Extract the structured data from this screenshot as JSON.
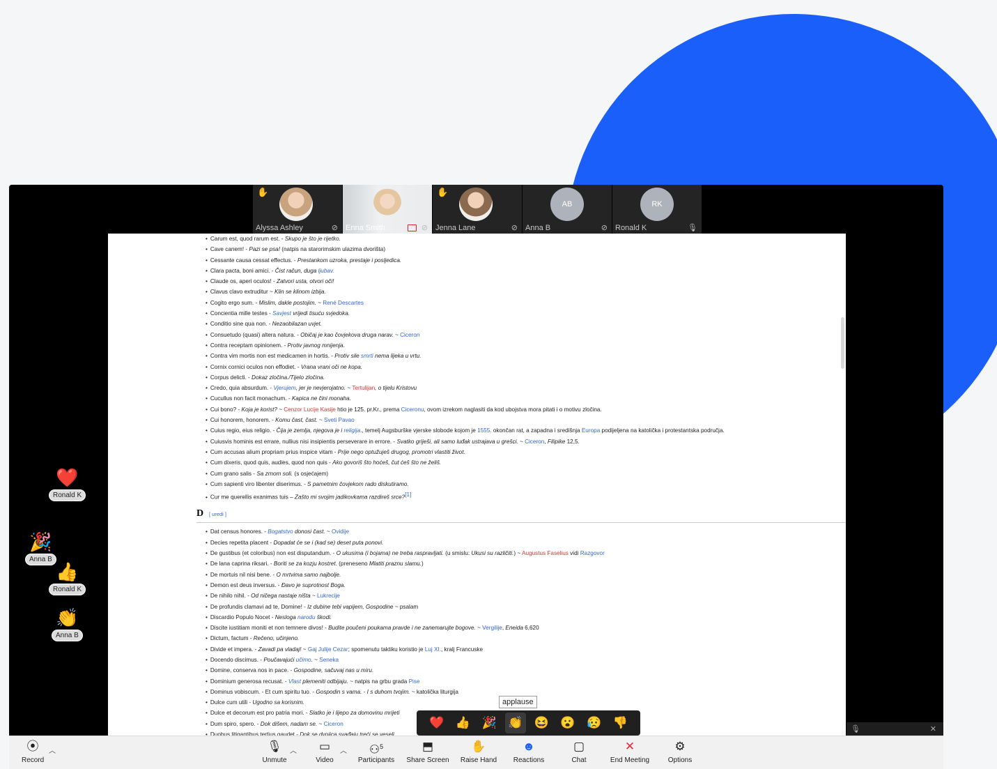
{
  "participants": [
    {
      "name": "Alyssa Ashley",
      "hand": true,
      "type": "photo",
      "color": "#c9a27e",
      "mic": "muted"
    },
    {
      "name": "Enna Smith",
      "hand": false,
      "type": "video",
      "color": "#e2d4c4",
      "mic": "muted",
      "sharing": true
    },
    {
      "name": "Jenna Lane",
      "hand": true,
      "type": "photo",
      "color": "#8c6a4f",
      "mic": "muted"
    },
    {
      "name": "Anna B",
      "hand": false,
      "type": "initials",
      "initials": "AB",
      "mic": "muted"
    },
    {
      "name": "Ronald K",
      "hand": false,
      "type": "initials",
      "initials": "RK",
      "mic": "on"
    }
  ],
  "doc": {
    "edit_label": "[ uredi ]",
    "section_letter": "D",
    "c_entries": [
      [
        {
          "t": "Carum est, quod rarum est. - "
        },
        {
          "t": "Skupo je što je rijetko.",
          "s": "i"
        }
      ],
      [
        {
          "t": "Cave canem! - "
        },
        {
          "t": "Pazi se psa!",
          "s": "i"
        },
        {
          "t": " (natpis na starorimskim ulazima dvorišta)"
        }
      ],
      [
        {
          "t": "Cessante causa cessat effectus. - "
        },
        {
          "t": "Prestankom uzroka, prestaje i posljedica.",
          "s": "i"
        }
      ],
      [
        {
          "t": "Clara pacta, boni amici. - "
        },
        {
          "t": "Čist račun, duga ",
          "s": "i"
        },
        {
          "t": "ljubav.",
          "s": "il"
        }
      ],
      [
        {
          "t": "Claude os, aperi oculos! - "
        },
        {
          "t": "Zatvori usta, otvori oči!",
          "s": "i"
        }
      ],
      [
        {
          "t": "Clavus clavo extruditur ~ "
        },
        {
          "t": "Klin se klinom izbija.",
          "s": "i"
        }
      ],
      [
        {
          "t": "Cogito ergo sum. - "
        },
        {
          "t": "Mislim, dakle postojim.",
          "s": "i"
        },
        {
          "t": " ~ "
        },
        {
          "t": "René Descartes",
          "s": "l"
        }
      ],
      [
        {
          "t": "Concientia mille testes - "
        },
        {
          "t": "Savjest",
          "s": "il"
        },
        {
          "t": " vrijedi tisuću svjedoka.",
          "s": "i"
        }
      ],
      [
        {
          "t": "Conditio sine qua non. - "
        },
        {
          "t": "Nezaobilazan uvjet.",
          "s": "i"
        }
      ],
      [
        {
          "t": "Consuetudo (quasi) altera natura. - "
        },
        {
          "t": "Običaj je kao čovjekova druga narav.",
          "s": "i"
        },
        {
          "t": " ~ "
        },
        {
          "t": "Ciceron",
          "s": "l"
        }
      ],
      [
        {
          "t": "Contra receptam opinionem. - "
        },
        {
          "t": "Protiv javnog mnijenja.",
          "s": "i"
        }
      ],
      [
        {
          "t": "Contra vim mortis non est medicamen in hortis. - "
        },
        {
          "t": "Protiv sile ",
          "s": "i"
        },
        {
          "t": "smrti",
          "s": "il"
        },
        {
          "t": " nema lijeka u vrtu.",
          "s": "i"
        }
      ],
      [
        {
          "t": "Cornix cornici oculos non effodiet. - "
        },
        {
          "t": "Vrana vrani oči ne kopa.",
          "s": "i"
        }
      ],
      [
        {
          "t": "Corpus delicti. - "
        },
        {
          "t": "Dokaz zločina./Tijelo zločina.",
          "s": "i"
        }
      ],
      [
        {
          "t": "Credo, quia absurdum. - "
        },
        {
          "t": "Vjerujem",
          "s": "il"
        },
        {
          "t": ", jer je nevjerojatno.",
          "s": "i"
        },
        {
          "t": " ~ "
        },
        {
          "t": "Tertulijan",
          "s": "r"
        },
        {
          "t": ", o tijelu Kristovu",
          "s": "i"
        }
      ],
      [
        {
          "t": "Cucullus non facit monachum. - "
        },
        {
          "t": "Kapica ne čini monaha.",
          "s": "i"
        }
      ],
      [
        {
          "t": "Cui bono? - "
        },
        {
          "t": "Koja je korist?",
          "s": "i"
        },
        {
          "t": " ~ "
        },
        {
          "t": "Cenzor Lucije Kasije",
          "s": "r"
        },
        {
          "t": " htio je 125. pr.Kr., prema "
        },
        {
          "t": "Ciceronu",
          "s": "l"
        },
        {
          "t": ", ovom izrekom naglasiti da kod ubojstva mora pitati i o motivu zločina."
        }
      ],
      [
        {
          "t": "Cui honorem, honorem. - "
        },
        {
          "t": "Komu čast, čast.",
          "s": "i"
        },
        {
          "t": " ~ "
        },
        {
          "t": "Sveti Pavao",
          "s": "l"
        }
      ],
      [
        {
          "t": "Cuius regio, eius religio. - "
        },
        {
          "t": "Čija je zemlja, njegova je i ",
          "s": "i"
        },
        {
          "t": "religija",
          "s": "il"
        },
        {
          "t": "., temelj Augsburške vjerske slobode kojom je "
        },
        {
          "t": "1555.",
          "s": "l"
        },
        {
          "t": " okončan rat, a zapadna i središnja "
        },
        {
          "t": "Europa",
          "s": "l"
        },
        {
          "t": " podijeljena na katolička i protestantska područja."
        }
      ],
      [
        {
          "t": "Cuiusvis hominis est errare, nullius nisi insipientis perseverare in errore. - "
        },
        {
          "t": "Svatko griješi, ali samo luđak ustrajava u grešci.",
          "s": "i"
        },
        {
          "t": " ~ "
        },
        {
          "t": "Ciceron",
          "s": "l"
        },
        {
          "t": ", "
        },
        {
          "t": "Filipike",
          "s": "i"
        },
        {
          "t": " 12,5."
        }
      ],
      [
        {
          "t": "Cum accusas alium propriam prius inspice vitam - "
        },
        {
          "t": "Prije nego optužuješ drugog, promotri vlastiti život.",
          "s": "i"
        }
      ],
      [
        {
          "t": "Cum dixeris, quod quis, audies, quod non quis - "
        },
        {
          "t": "Ako govoriš što hoćeš, čut ćeš što ne želiš.",
          "s": "i"
        }
      ],
      [
        {
          "t": "Cum grano salis - "
        },
        {
          "t": "Sa zrnom soli.",
          "s": "i"
        },
        {
          "t": " (s osjećajem)"
        }
      ],
      [
        {
          "t": "Cum sapienti viro libenter diserimus. - "
        },
        {
          "t": "S pametnim čovjekom rado diskutiramo.",
          "s": "i"
        }
      ],
      [
        {
          "t": "Cur me querellis exanimas tuis – "
        },
        {
          "t": "Zašto mi svojim jadikovkama razdireš srce?",
          "s": "i"
        },
        {
          "t": "[1]",
          "s": "l"
        }
      ]
    ],
    "d_entries": [
      [
        {
          "t": "Dat census honores. - "
        },
        {
          "t": "Bogatstvo",
          "s": "il"
        },
        {
          "t": " donosi čast.",
          "s": "i"
        },
        {
          "t": " ~ "
        },
        {
          "t": "Ovidije",
          "s": "l"
        }
      ],
      [
        {
          "t": "Decies repetita placent - "
        },
        {
          "t": "Dopadat će se i (kad se) deset puta ponovi.",
          "s": "i"
        }
      ],
      [
        {
          "t": "De gustibus (et coloribus) non est disputandum. - "
        },
        {
          "t": "O ukusima (i bojama) ne treba raspravljati.",
          "s": "i"
        },
        {
          "t": " (u smislu: "
        },
        {
          "t": "Ukusi su različiti.",
          "s": "i"
        },
        {
          "t": ") ~ "
        },
        {
          "t": "Augustus Faselius",
          "s": "r"
        },
        {
          "t": " vidi "
        },
        {
          "t": "Razgovor",
          "s": "l"
        }
      ],
      [
        {
          "t": "De lana caprina riksari. - "
        },
        {
          "t": "Boriti se za kozju kostret.",
          "s": "i"
        },
        {
          "t": " (preneseno "
        },
        {
          "t": "Mlatiti praznu slamu.",
          "s": "i"
        },
        {
          "t": ")"
        }
      ],
      [
        {
          "t": "De mortuis nil nisi bene. - "
        },
        {
          "t": "O mrtvima samo najbolje.",
          "s": "i"
        }
      ],
      [
        {
          "t": "Demon est deus inversus. - "
        },
        {
          "t": "Đavo je suprotnost Boga.",
          "s": "i"
        }
      ],
      [
        {
          "t": "De nihilo nihil. - "
        },
        {
          "t": "Od ničega nastaje ništa",
          "s": "i"
        },
        {
          "t": " ~ "
        },
        {
          "t": "Lukrecije",
          "s": "l"
        }
      ],
      [
        {
          "t": "De profundis clamavi ad te, Domine! - "
        },
        {
          "t": "Iz dubine tebi vapijem, Gospodine",
          "s": "i"
        },
        {
          "t": " ~ psalam"
        }
      ],
      [
        {
          "t": "Discardio Populo Nocet - "
        },
        {
          "t": "Nesloga ",
          "s": "i"
        },
        {
          "t": "narodu",
          "s": "il"
        },
        {
          "t": " škodi.",
          "s": "i"
        }
      ],
      [
        {
          "t": "Discite iustitiam moniti et non temnere divos! - "
        },
        {
          "t": "Budite poučeni poukama pravde i ne zanemarujte bogove.",
          "s": "i"
        },
        {
          "t": " ~ "
        },
        {
          "t": "Vergilije",
          "s": "l"
        },
        {
          "t": ", "
        },
        {
          "t": "Eneida",
          "s": "i"
        },
        {
          "t": " 6,620"
        }
      ],
      [
        {
          "t": "Dictum, factum - "
        },
        {
          "t": "Rečeno, učinjeno.",
          "s": "i"
        }
      ],
      [
        {
          "t": "Divide et impera. - "
        },
        {
          "t": "Zavadi pa vladaj!",
          "s": "i"
        },
        {
          "t": " ~ "
        },
        {
          "t": "Gaj Julije Cezar",
          "s": "l"
        },
        {
          "t": "; spomenutu taktiku koristio je "
        },
        {
          "t": "Luj XI.",
          "s": "l"
        },
        {
          "t": ", kralj Francuske"
        }
      ],
      [
        {
          "t": "Docendo discimus. - "
        },
        {
          "t": "Poučavajući ",
          "s": "i"
        },
        {
          "t": "učimo",
          "s": "il"
        },
        {
          "t": ".",
          "s": "i"
        },
        {
          "t": " ~ "
        },
        {
          "t": "Seneka",
          "s": "l"
        }
      ],
      [
        {
          "t": "Domine, conserva nos in pace. - "
        },
        {
          "t": "Gospodine, sačuvaj nas u miru.",
          "s": "i"
        }
      ],
      [
        {
          "t": "Dominium generosa recusat. - "
        },
        {
          "t": "Vlast",
          "s": "il"
        },
        {
          "t": " plemeniti odbijaju.",
          "s": "i"
        },
        {
          "t": " ~ natpis na grbu grada "
        },
        {
          "t": "Pise",
          "s": "l"
        }
      ],
      [
        {
          "t": "Dominus vobiscum. - Et cum spiritu tuo. - "
        },
        {
          "t": "Gospodin s vama. - I s duhom tvojim.",
          "s": "i"
        },
        {
          "t": " ~ katolička liturgija"
        }
      ],
      [
        {
          "t": "Dulce cum utili - "
        },
        {
          "t": "Ugodno sa korisnim.",
          "s": "i"
        }
      ],
      [
        {
          "t": "Dulce et decorum est pro patria mori. - "
        },
        {
          "t": "Slatko je i lijepo za domovinu mrijeti",
          "s": "i"
        }
      ],
      [
        {
          "t": "Dum spiro, spero. - "
        },
        {
          "t": "Dok dišem, nadam se.",
          "s": "i"
        },
        {
          "t": " ~ "
        },
        {
          "t": "Ciceron",
          "s": "l"
        }
      ],
      [
        {
          "t": "Duobus litigantibus tertius gaudet - "
        },
        {
          "t": "Dok se dvojica svađaju treći se veseli.",
          "s": "i"
        }
      ]
    ]
  },
  "reactions_feed": [
    {
      "emoji": "❤️",
      "name": "Ronald K",
      "icon": "heart-icon"
    },
    {
      "emoji": "🎉",
      "name": "Anna B",
      "icon": "party-popper-icon"
    },
    {
      "emoji": "👍",
      "name": "Ronald K",
      "icon": "thumbs-up-icon"
    },
    {
      "emoji": "👏",
      "name": "Anna B",
      "icon": "clapping-hands-icon"
    }
  ],
  "palette": {
    "tooltip": "applause",
    "items": [
      {
        "emoji": "❤️",
        "name": "heart"
      },
      {
        "emoji": "👍",
        "name": "thumbs-up"
      },
      {
        "emoji": "🎉",
        "name": "party"
      },
      {
        "emoji": "👏",
        "name": "applause",
        "selected": true
      },
      {
        "emoji": "😆",
        "name": "laugh"
      },
      {
        "emoji": "😮",
        "name": "surprised"
      },
      {
        "emoji": "😥",
        "name": "sad"
      },
      {
        "emoji": "👎",
        "name": "thumbs-down"
      }
    ]
  },
  "toolbar": {
    "record": "Record",
    "unmute": "Unmute",
    "video": "Video",
    "participants": "Participants",
    "participants_count": "5",
    "share": "Share Screen",
    "raise_hand": "Raise Hand",
    "reactions": "Reactions",
    "chat": "Chat",
    "end": "End Meeting",
    "options": "Options"
  },
  "colors": {
    "accent": "#1b5ffa",
    "link": "#3366cc",
    "redlink": "#dd3333",
    "end": "#e0283d"
  }
}
